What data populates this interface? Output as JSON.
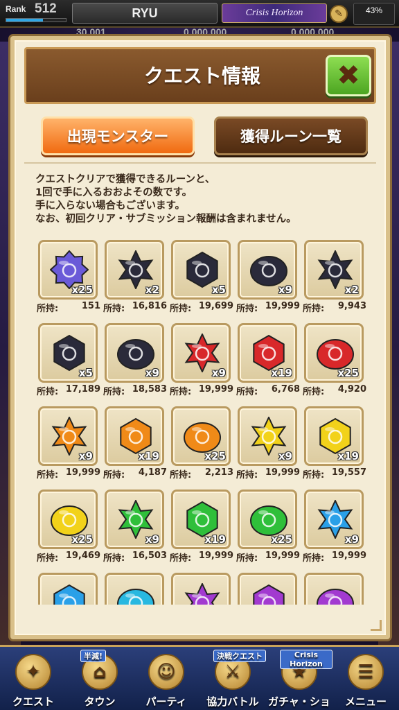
{
  "topbar": {
    "rank_label": "Rank",
    "rank_value": "512",
    "player_name": "RYU",
    "banner": "Crisis Horizon",
    "battery": "43%",
    "sub_left": "30,001",
    "sub_mid": "0,000,000",
    "sub_right": "0,000,000"
  },
  "modal": {
    "title": "クエスト情報",
    "tabs": {
      "monsters": "出現モンスター",
      "runes": "獲得ルーン一覧"
    },
    "description": [
      "クエストクリアで獲得できるルーンと、",
      "1回で手に入るおおよその数です。",
      "手に入らない場合もございます。",
      "なお、初回クリア・サブミッション報酬は含まれません。"
    ],
    "owned_label": "所持:",
    "runes": [
      {
        "icon": "cosmic-rune-icon",
        "count": "x25",
        "owned": "151",
        "color": "#6a5ad8",
        "shape": "star8"
      },
      {
        "icon": "dark-rune-icon",
        "count": "x2",
        "owned": "16,816",
        "color": "#2a2a3a",
        "shape": "star6"
      },
      {
        "icon": "dark-rune-icon",
        "count": "x5",
        "owned": "19,699",
        "color": "#2a2a3a",
        "shape": "hex"
      },
      {
        "icon": "dark-rune-icon",
        "count": "x9",
        "owned": "19,999",
        "color": "#2a2a3a",
        "shape": "blob"
      },
      {
        "icon": "dark-green-rune-icon",
        "count": "x2",
        "owned": "9,943",
        "color": "#2a2a3a",
        "shape": "star6"
      },
      {
        "icon": "dark-green-rune-icon",
        "count": "x5",
        "owned": "17,189",
        "color": "#2a2a3a",
        "shape": "hex"
      },
      {
        "icon": "dark-green-rune-icon",
        "count": "x9",
        "owned": "18,583",
        "color": "#2a2a3a",
        "shape": "blob"
      },
      {
        "icon": "red-rune-icon",
        "count": "x9",
        "owned": "19,999",
        "color": "#d8282a",
        "shape": "star6"
      },
      {
        "icon": "red-rune-icon",
        "count": "x19",
        "owned": "6,768",
        "color": "#d8282a",
        "shape": "hex"
      },
      {
        "icon": "red-rune-icon",
        "count": "x25",
        "owned": "4,920",
        "color": "#d8282a",
        "shape": "blob"
      },
      {
        "icon": "orange-rune-icon",
        "count": "x9",
        "owned": "19,999",
        "color": "#f08a18",
        "shape": "star6"
      },
      {
        "icon": "orange-rune-icon",
        "count": "x19",
        "owned": "4,187",
        "color": "#f08a18",
        "shape": "hex"
      },
      {
        "icon": "orange-rune-icon",
        "count": "x25",
        "owned": "2,213",
        "color": "#f08a18",
        "shape": "blob"
      },
      {
        "icon": "yellow-rune-icon",
        "count": "x9",
        "owned": "19,999",
        "color": "#f2d21a",
        "shape": "star6"
      },
      {
        "icon": "yellow-rune-icon",
        "count": "x19",
        "owned": "19,557",
        "color": "#f2d21a",
        "shape": "hex"
      },
      {
        "icon": "yellow-rune-icon",
        "count": "x25",
        "owned": "19,469",
        "color": "#f2d21a",
        "shape": "blob"
      },
      {
        "icon": "green-rune-icon",
        "count": "x9",
        "owned": "16,503",
        "color": "#2fbf3a",
        "shape": "star6"
      },
      {
        "icon": "green-rune-icon",
        "count": "x19",
        "owned": "19,999",
        "color": "#2fbf3a",
        "shape": "hex"
      },
      {
        "icon": "green-rune-icon",
        "count": "x25",
        "owned": "19,999",
        "color": "#2fbf3a",
        "shape": "blob"
      },
      {
        "icon": "blue-rune-icon",
        "count": "x9",
        "owned": "19,999",
        "color": "#2aa0e8",
        "shape": "star6"
      },
      {
        "icon": "blue-rune-icon",
        "count": "",
        "owned": "",
        "color": "#2aa0e8",
        "shape": "hex"
      },
      {
        "icon": "cyan-rune-icon",
        "count": "",
        "owned": "",
        "color": "#28b8e0",
        "shape": "blob"
      },
      {
        "icon": "purple-rune-icon",
        "count": "",
        "owned": "",
        "color": "#a23ad0",
        "shape": "star6"
      },
      {
        "icon": "purple-rune-icon",
        "count": "",
        "owned": "",
        "color": "#a23ad0",
        "shape": "hex"
      },
      {
        "icon": "purple-rune-icon",
        "count": "",
        "owned": "",
        "color": "#a23ad0",
        "shape": "blob"
      }
    ]
  },
  "bottomnav": {
    "items": [
      {
        "label": "クエスト",
        "icon": "quest-icon"
      },
      {
        "label": "タウン",
        "icon": "town-icon",
        "badge": "半減!"
      },
      {
        "label": "パーティ",
        "icon": "party-icon"
      },
      {
        "label": "協力バトル",
        "icon": "coop-battle-icon",
        "badge": "決戦クエスト"
      },
      {
        "label": "ガチャ・ショップ",
        "icon": "gacha-shop-icon",
        "badge": "Crisis Horizon"
      },
      {
        "label": "メニュー",
        "icon": "menu-icon"
      }
    ]
  }
}
